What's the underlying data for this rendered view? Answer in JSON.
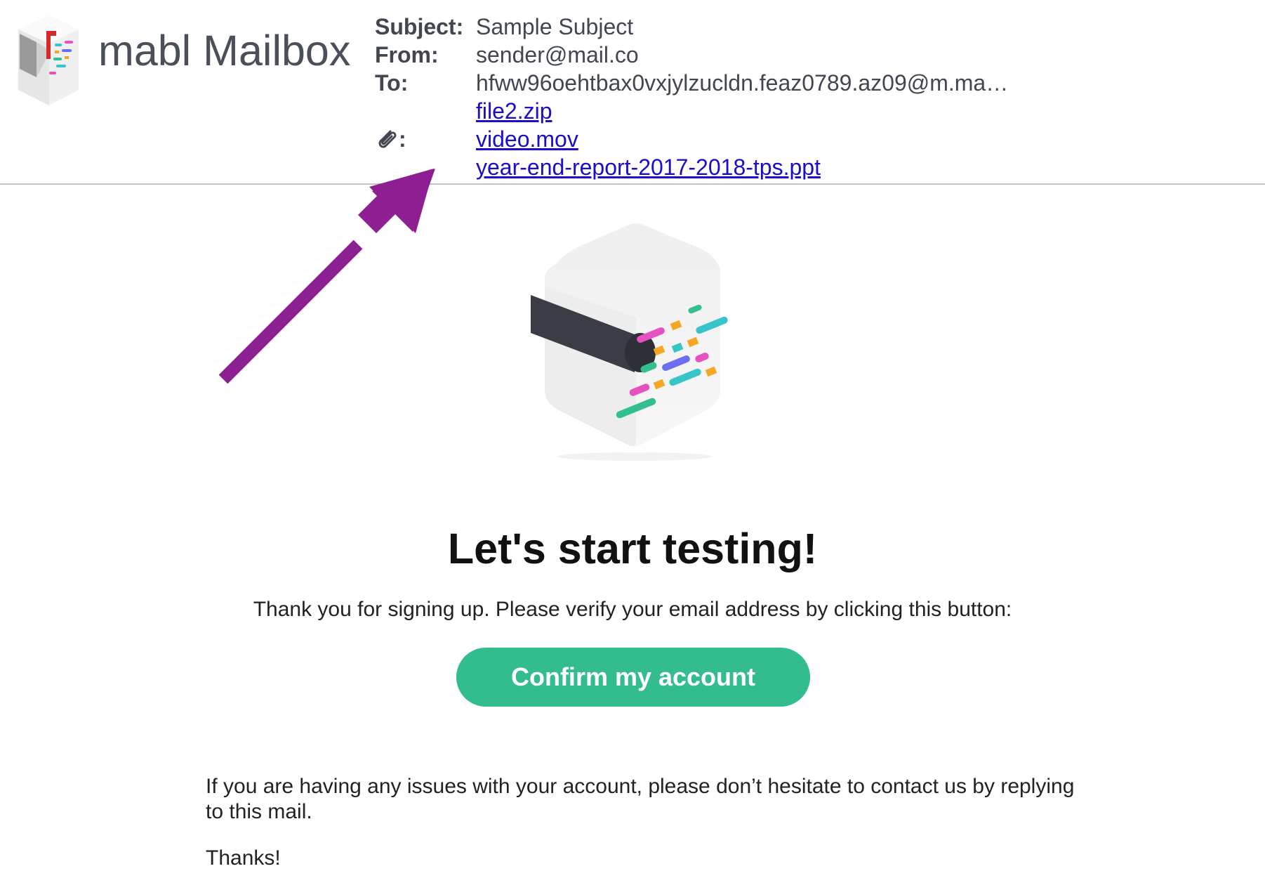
{
  "app": {
    "title": "mabl Mailbox"
  },
  "email": {
    "subject_label": "Subject:",
    "subject": "Sample Subject",
    "from_label": "From:",
    "from": "sender@mail.co",
    "to_label": "To:",
    "to": "hfww96oehtbax0vxjylzucldn.feaz0789.az09@m.ma…",
    "attachments_label": ":",
    "attachments": [
      "file2.zip",
      "video.mov",
      "year-end-report-2017-2018-tps.ppt"
    ]
  },
  "body": {
    "headline": "Let's start testing!",
    "intro": "Thank you for signing up. Please verify your email address by clicking this button:",
    "cta_label": "Confirm my account",
    "support_text": "If you are having any issues with your account, please don’t hesitate to contact us by replying to this mail.",
    "signoff": "Thanks!"
  },
  "icons": {
    "brand": "mabl-mailbox-logo",
    "attachment": "paperclip-icon",
    "hero": "mabl-cube-logo",
    "annotation": "arrow-icon"
  },
  "colors": {
    "link": "#1a0dcc",
    "cta": "#33bd8f",
    "annotation_arrow": "#8e1f93",
    "label_text": "#424650"
  }
}
